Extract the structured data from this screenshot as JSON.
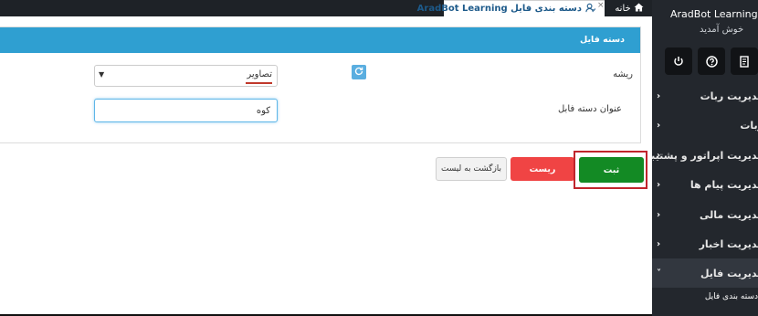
{
  "tabs": {
    "home": {
      "label": "خانه",
      "icon": "home-icon"
    },
    "active": {
      "label": "دسته بندی فایل AradBot Learning",
      "icon": "user-icon",
      "close": "×"
    }
  },
  "sidebar": {
    "brand": "AradBot Learning",
    "welcome": "خوش آمدید",
    "icons": [
      "logout-icon",
      "help-icon",
      "document-icon"
    ],
    "items": [
      {
        "label": "مدیریت ربات"
      },
      {
        "label": "ربات"
      },
      {
        "label": "مدیریت اپراتور و پشتیبانی"
      },
      {
        "label": "مدیریت پیام ها"
      },
      {
        "label": "مدیریت مالی"
      },
      {
        "label": "مدیریت اخبار"
      },
      {
        "label": "مدیریت فایل"
      }
    ],
    "submenu": {
      "label": "دسته بندی فایل"
    }
  },
  "panel": {
    "title": "دسته فایل",
    "root_label": "ریشه",
    "root_value": "تصاویر",
    "name_label": "عنوان دسته فابل",
    "name_value": "کوه"
  },
  "buttons": {
    "submit": "ثبت",
    "reset": "ریست",
    "back": "بازگشت به لیست"
  },
  "colors": {
    "sidebar_bg": "#23272d",
    "panel_header": "#2f9fd1",
    "submit": "#138a24",
    "reset": "#f04444",
    "highlight_border": "#c0252c"
  }
}
